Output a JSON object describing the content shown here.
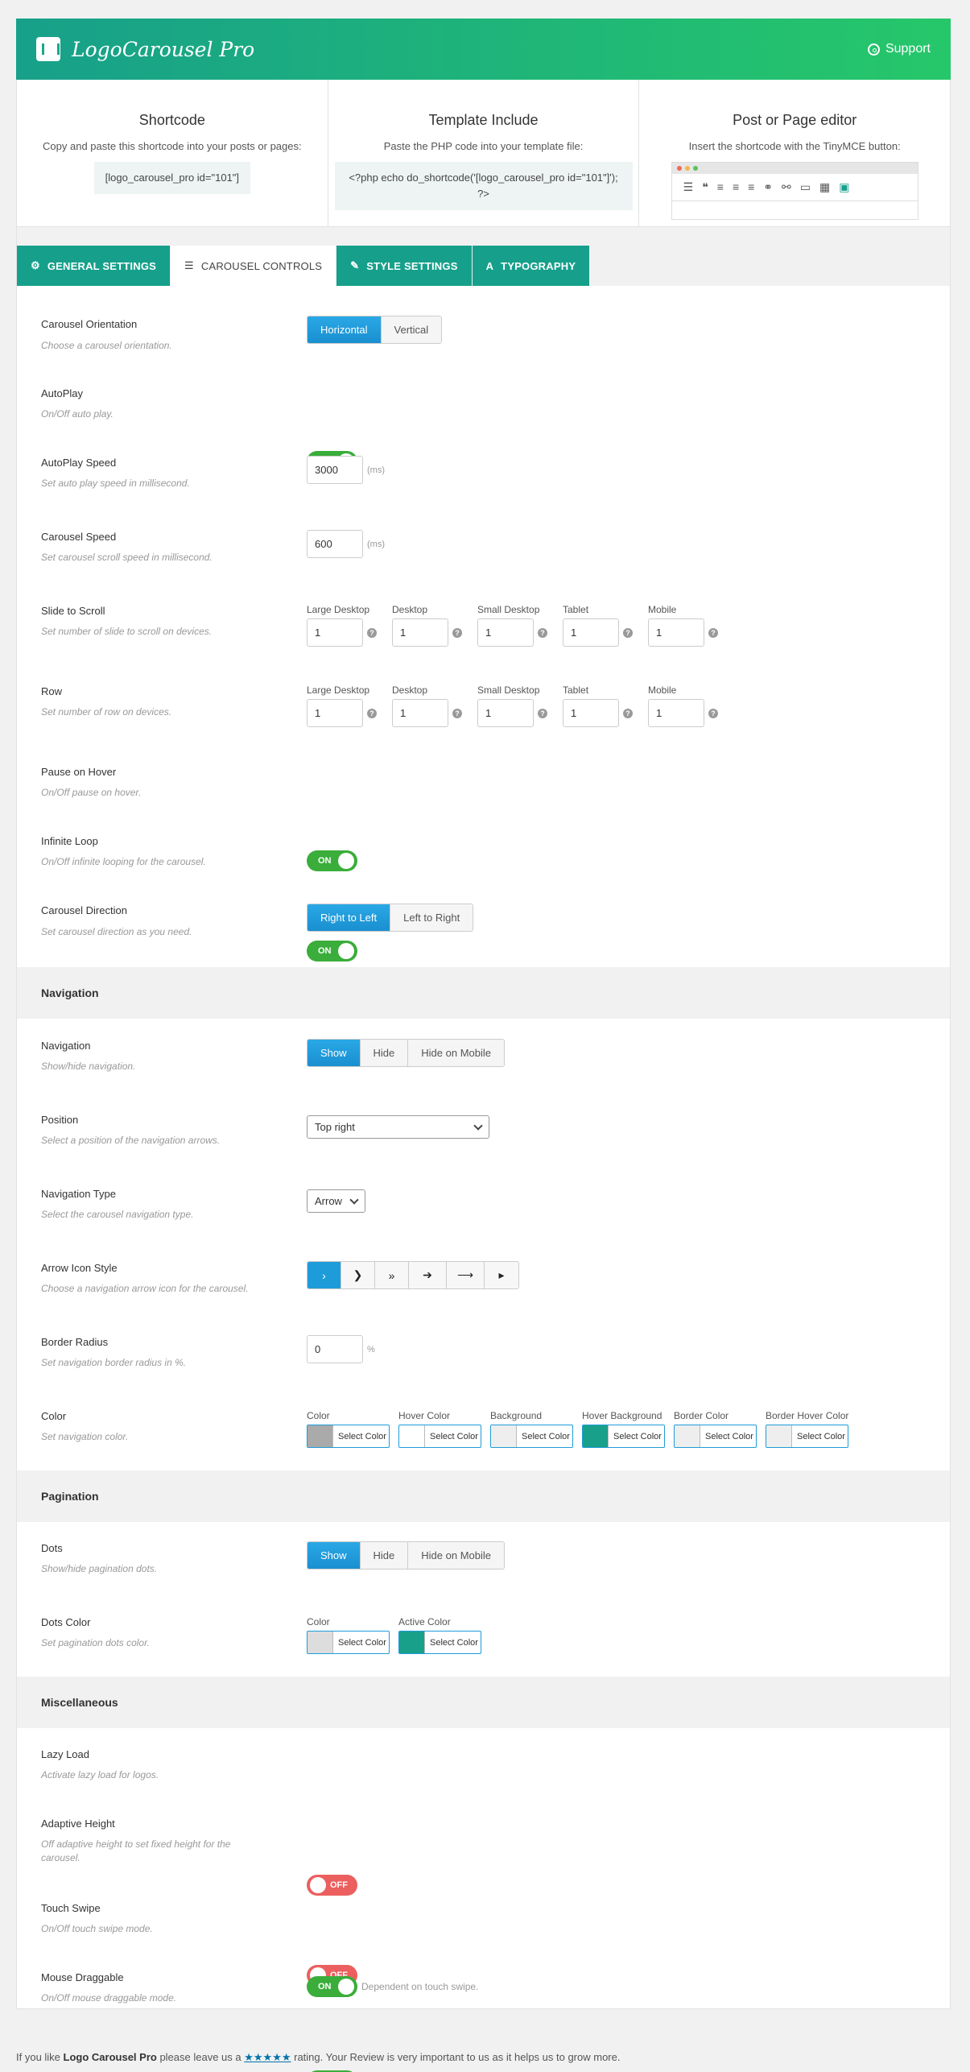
{
  "header": {
    "title": "LogoCarousel Pro",
    "support": "Support"
  },
  "top": {
    "shortcode": {
      "title": "Shortcode",
      "desc": "Copy and paste this shortcode into your posts or pages:",
      "code": "[logo_carousel_pro id=\"101\"]"
    },
    "template": {
      "title": "Template Include",
      "desc": "Paste the PHP code into your template file:",
      "code": "<?php echo do_shortcode('[logo_carousel_pro id=\"101\"]'); ?>"
    },
    "editor": {
      "title": "Post or Page editor",
      "desc": "Insert the shortcode with the TinyMCE button:"
    }
  },
  "tabs": [
    {
      "label": "General Settings",
      "icon": "gear-icon",
      "glyph": "⚙"
    },
    {
      "label": "Carousel Controls",
      "icon": "sliders-icon",
      "glyph": "☰"
    },
    {
      "label": "Style Settings",
      "icon": "brush-icon",
      "glyph": "✎"
    },
    {
      "label": "Typography",
      "icon": "font-icon",
      "glyph": "A"
    }
  ],
  "fields": {
    "orientation": {
      "label": "Carousel Orientation",
      "desc": "Choose a carousel orientation.",
      "options": [
        "Horizontal",
        "Vertical"
      ]
    },
    "autoplay": {
      "label": "AutoPlay",
      "desc": "On/Off auto play.",
      "state": "ON"
    },
    "autoplay_speed": {
      "label": "AutoPlay Speed",
      "desc": "Set auto play speed in millisecond.",
      "value": "3000",
      "unit": "(ms)"
    },
    "carousel_speed": {
      "label": "Carousel Speed",
      "desc": "Set carousel scroll speed in millisecond.",
      "value": "600",
      "unit": "(ms)"
    },
    "slide_to_scroll": {
      "label": "Slide to Scroll",
      "desc": "Set number of slide to scroll on devices."
    },
    "row": {
      "label": "Row",
      "desc": "Set number of row on devices."
    },
    "devices": [
      "Large Desktop",
      "Desktop",
      "Small Desktop",
      "Tablet",
      "Mobile"
    ],
    "device_value": "1",
    "help": "?",
    "pause_hover": {
      "label": "Pause on Hover",
      "desc": "On/Off pause on hover.",
      "state": "ON"
    },
    "infinite_loop": {
      "label": "Infinite Loop",
      "desc": "On/Off infinite looping for the carousel.",
      "state": "ON"
    },
    "direction": {
      "label": "Carousel Direction",
      "desc": "Set carousel direction as you need.",
      "options": [
        "Right to Left",
        "Left to Right"
      ]
    }
  },
  "navigation": {
    "section": "Navigation",
    "nav": {
      "label": "Navigation",
      "desc": "Show/hide navigation.",
      "options": [
        "Show",
        "Hide",
        "Hide on Mobile"
      ]
    },
    "position": {
      "label": "Position",
      "desc": "Select a position of the navigation arrows.",
      "value": "Top right"
    },
    "type": {
      "label": "Navigation Type",
      "desc": "Select the carousel navigation type.",
      "value": "Arrow"
    },
    "arrow_style": {
      "label": "Arrow Icon Style",
      "desc": "Choose a navigation arrow icon for the carousel.",
      "icons": [
        "›",
        "❯",
        "»",
        "➔",
        "⟶",
        "▸"
      ]
    },
    "radius": {
      "label": "Border Radius",
      "desc": "Set navigation border radius in %.",
      "value": "0",
      "unit": "%"
    },
    "color": {
      "label": "Color",
      "desc": "Set navigation color.",
      "select": "Select Color",
      "items": [
        {
          "label": "Color",
          "swatch": "#aaaaaa"
        },
        {
          "label": "Hover Color",
          "swatch": "#ffffff"
        },
        {
          "label": "Background",
          "swatch": "#eeeeee"
        },
        {
          "label": "Hover Background",
          "swatch": "#18a08b"
        },
        {
          "label": "Border Color",
          "swatch": "#eeeeee"
        },
        {
          "label": "Border Hover Color",
          "swatch": "#eeeeee"
        }
      ]
    }
  },
  "pagination": {
    "section": "Pagination",
    "dots": {
      "label": "Dots",
      "desc": "Show/hide pagination dots.",
      "options": [
        "Show",
        "Hide",
        "Hide on Mobile"
      ]
    },
    "dots_color": {
      "label": "Dots Color",
      "desc": "Set pagination dots color.",
      "items": [
        {
          "label": "Color",
          "swatch": "#dddddd"
        },
        {
          "label": "Active Color",
          "swatch": "#18a08b"
        }
      ]
    }
  },
  "misc": {
    "section": "Miscellaneous",
    "lazy": {
      "label": "Lazy Load",
      "desc": "Activate lazy load for logos.",
      "state": "OFF"
    },
    "adaptive": {
      "label": "Adaptive Height",
      "desc": "Off adaptive height to set fixed height for the carousel.",
      "state": "OFF"
    },
    "touch": {
      "label": "Touch Swipe",
      "desc": "On/Off touch swipe mode.",
      "state": "ON"
    },
    "drag": {
      "label": "Mouse Draggable",
      "desc": "On/Off mouse draggable mode.",
      "state": "ON",
      "note": "Dependent on touch swipe."
    }
  },
  "footer": {
    "pre": "If you like ",
    "product": "Logo Carousel Pro",
    "mid": " please leave us a ",
    "stars": "★★★★★",
    "post": " rating. Your Review is very important to us as it helps us to grow more."
  },
  "colors": {
    "accent": "#18a08b",
    "button_on": "#1e9cd9",
    "toggle_on": "#3aad3a",
    "toggle_off": "#ec5f5f"
  }
}
